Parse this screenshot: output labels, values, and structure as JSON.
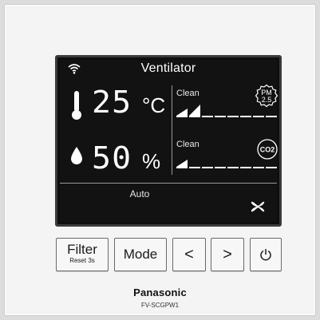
{
  "device": {
    "brand": "Panasonic",
    "model": "FV-SCGPW1"
  },
  "display": {
    "title": "Ventilator",
    "temperature": {
      "value": "25",
      "unit": "°C"
    },
    "humidity": {
      "value": "50",
      "unit": "%"
    },
    "pm_sensor": {
      "label_top": "PM",
      "label_bottom": "2.5",
      "status": "Clean",
      "level": 2,
      "max_level": 8
    },
    "co2_sensor": {
      "label": "CO2",
      "status": "Clean",
      "level": 1,
      "max_level": 8
    },
    "mode": "Auto",
    "icons": [
      "wifi-icon",
      "thermometer-icon",
      "humidity-drop-icon",
      "fan-icon"
    ]
  },
  "buttons": {
    "filter": {
      "label": "Filter",
      "sub_label": "Reset 3s"
    },
    "mode": {
      "label": "Mode"
    },
    "left": {
      "label": "<"
    },
    "right": {
      "label": ">"
    },
    "power": {
      "icon": "power-icon"
    }
  },
  "colors": {
    "screen_bg": "#121212",
    "text": "#ffffff",
    "panel": "#f4f4f4"
  }
}
